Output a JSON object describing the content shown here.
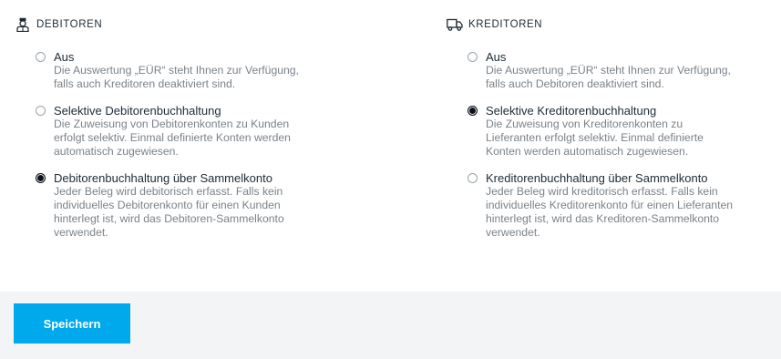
{
  "debitoren": {
    "title": "DEBITOREN",
    "icon": "user-icon",
    "options": [
      {
        "label": "Aus",
        "desc": [
          "Die Auswertung „EÜR“ steht Ihnen zur Verfügung,",
          "falls auch Kreditoren deaktiviert sind."
        ],
        "checked": false
      },
      {
        "label": "Selektive Debitorenbuchhaltung",
        "desc": [
          "Die Zuweisung von Debitorenkonten zu Kunden",
          "erfolgt selektiv. Einmal definierte Konten werden",
          "automatisch zugewiesen."
        ],
        "checked": false
      },
      {
        "label": "Debitorenbuchhaltung über Sammelkonto",
        "desc": [
          "Jeder Beleg wird debitorisch erfasst. Falls kein",
          "individuelles Debitorenkonto für einen Kunden",
          "hinterlegt ist, wird das Debitoren-Sammelkonto",
          "verwendet."
        ],
        "checked": true
      }
    ]
  },
  "kreditoren": {
    "title": "KREDITOREN",
    "icon": "truck-icon",
    "options": [
      {
        "label": "Aus",
        "desc": [
          "Die Auswertung „EÜR“ steht Ihnen zur Verfügung,",
          "falls auch Debitoren deaktiviert sind."
        ],
        "checked": false
      },
      {
        "label": "Selektive Kreditorenbuchhaltung",
        "desc": [
          "Die Zuweisung von Kreditorenkonten zu",
          "Lieferanten erfolgt selektiv. Einmal definierte",
          "Konten werden automatisch zugewiesen."
        ],
        "checked": true
      },
      {
        "label": "Kreditorenbuchhaltung über Sammelkonto",
        "desc": [
          "Jeder Beleg wird kreditorisch erfasst. Falls kein",
          "individuelles Kreditorenkonto für einen Lieferanten",
          "hinterlegt ist, wird das Kreditoren-Sammelkonto",
          "verwendet."
        ],
        "checked": false
      }
    ]
  },
  "footer": {
    "save_label": "Speichern"
  },
  "colors": {
    "accent": "#00a8ec",
    "footer_bg": "#f3f4f5",
    "desc_text": "#7a828a"
  }
}
